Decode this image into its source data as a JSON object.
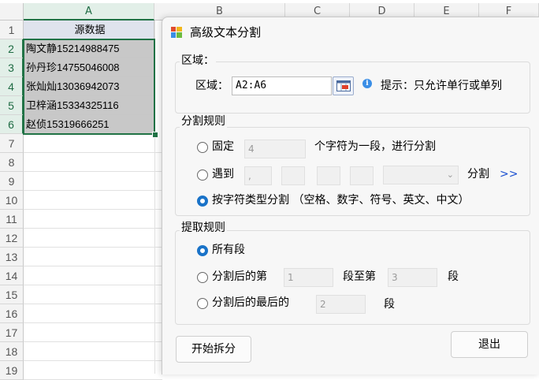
{
  "sheet": {
    "columns": [
      "A",
      "B",
      "C",
      "D",
      "E",
      "F"
    ],
    "rows": [
      "1",
      "2",
      "3",
      "4",
      "5",
      "6",
      "7",
      "8",
      "9",
      "10",
      "11",
      "12",
      "13",
      "14",
      "15",
      "16",
      "17",
      "18",
      "19"
    ],
    "header_cell": "源数据",
    "data": [
      "陶文静15214988475",
      "孙丹珍14755046008",
      "张灿灿13036942073",
      "卫梓涵15334325116",
      "赵侦15319666251"
    ]
  },
  "dialog": {
    "title": "高级文本分割",
    "region": {
      "group_title": "区域：",
      "label": "区域：",
      "value": "A2:A6",
      "hint": "提示：只允许单行或单列"
    },
    "split": {
      "group_title": "分割规则",
      "fixed_label": "固定",
      "fixed_value": "4",
      "fixed_suffix": "个字符为一段，进行分割",
      "meet_label": "遇到",
      "meet_value": ",",
      "meet_suffix": "分割",
      "more": ">>",
      "type_label": "按字符类型分割 （空格、数字、符号、英文、中文）"
    },
    "extract": {
      "group_title": "提取规则",
      "all_label": "所有段",
      "range_label": "分割后的第",
      "range_from": "1",
      "range_mid": "段至第",
      "range_to": "3",
      "range_suffix": "段",
      "last_label": "分割后的最后的",
      "last_value": "2",
      "last_suffix": "段"
    },
    "start_button": "开始拆分",
    "exit_button": "退出"
  },
  "colors": {
    "accent": "#217346",
    "radio_selected": "#1a73c8",
    "more_link": "#1a4fd0"
  }
}
